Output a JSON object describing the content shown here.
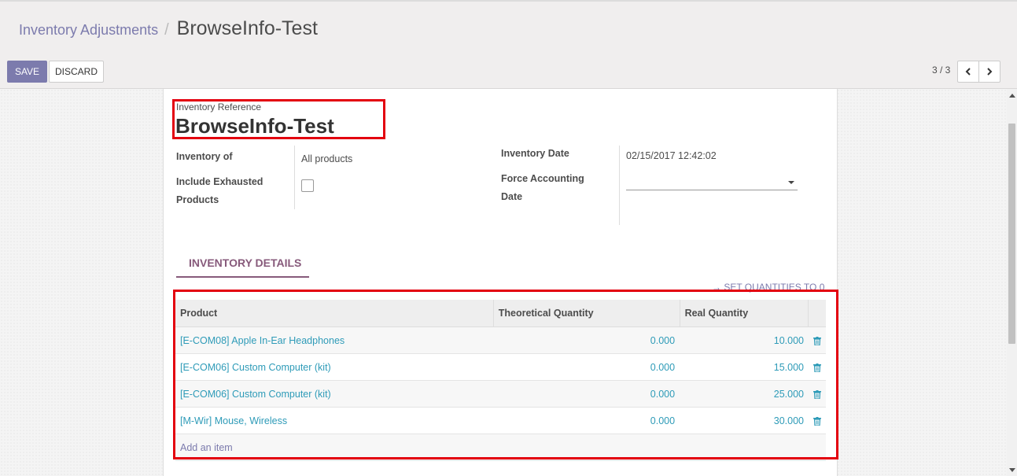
{
  "breadcrumb": {
    "parent": "Inventory Adjustments",
    "separator": "/",
    "current": "BrowseInfo-Test"
  },
  "buttons": {
    "save": "SAVE",
    "discard": "DISCARD"
  },
  "pager": {
    "value": "3 / 3"
  },
  "form": {
    "reference_label": "Inventory Reference",
    "reference_value": "BrowseInfo-Test",
    "inventory_of_label": "Inventory of",
    "inventory_of_value": "All products",
    "include_exhausted_label_1": "Include Exhausted",
    "include_exhausted_label_2": "Products",
    "include_exhausted_checked": false,
    "inventory_date_label": "Inventory Date",
    "inventory_date_value": "02/15/2017 12:42:02",
    "force_date_label_1": "Force Accounting",
    "force_date_label_2": "Date",
    "force_date_value": ""
  },
  "tab": {
    "label": "INVENTORY DETAILS"
  },
  "set_quantities": "→ SET QUANTITIES TO 0",
  "table": {
    "headers": [
      "Product",
      "Theoretical Quantity",
      "Real Quantity"
    ],
    "rows": [
      {
        "product": "[E-COM08] Apple In-Ear Headphones",
        "theoretical": "0.000",
        "real": "10.000"
      },
      {
        "product": "[E-COM06] Custom Computer (kit)",
        "theoretical": "0.000",
        "real": "15.000"
      },
      {
        "product": "[E-COM06] Custom Computer (kit)",
        "theoretical": "0.000",
        "real": "25.000"
      },
      {
        "product": "[M-Wir] Mouse, Wireless",
        "theoretical": "0.000",
        "real": "30.000"
      }
    ],
    "add_item": "Add an item"
  },
  "icons": {
    "prev": "chevron-left-icon",
    "next": "chevron-right-icon",
    "delete": "trash-icon",
    "dropdown": "caret-down-icon"
  },
  "colors": {
    "primary": "#7c7bad",
    "tab_accent": "#875a7b",
    "link": "#2e9bb8",
    "highlight": "#e3000f"
  }
}
